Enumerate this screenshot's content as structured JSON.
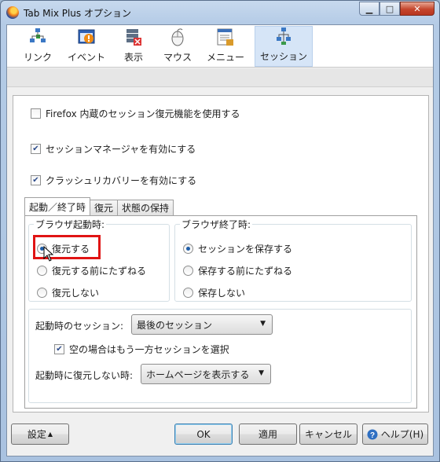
{
  "window": {
    "title": "Tab Mix Plus オプション"
  },
  "toolbar": {
    "items": [
      {
        "label": "リンク"
      },
      {
        "label": "イベント"
      },
      {
        "label": "表示"
      },
      {
        "label": "マウス"
      },
      {
        "label": "メニュー"
      },
      {
        "label": "セッション"
      }
    ]
  },
  "options": {
    "firefox_session": "Firefox 内蔵のセッション復元機能を使用する",
    "session_manager": "セッションマネージャを有効にする",
    "crash_recovery": "クラッシュリカバリーを有効にする"
  },
  "tabs": [
    "起動／終了時",
    "復元",
    "状態の保持"
  ],
  "startup_group": {
    "label": "ブラウザ起動時:",
    "options": [
      "復元する",
      "復元する前にたずねる",
      "復元しない"
    ]
  },
  "exit_group": {
    "label": "ブラウザ終了時:",
    "options": [
      "セッションを保存する",
      "保存する前にたずねる",
      "保存しない"
    ]
  },
  "session_settings": {
    "startup_session_label": "起動時のセッション:",
    "startup_session_value": "最後のセッション",
    "empty_choose": "空の場合はもう一方セッションを選択",
    "no_restore_label": "起動時に復元しない時:",
    "no_restore_value": "ホームページを表示する"
  },
  "footer": {
    "settings": "設定",
    "ok": "OK",
    "apply": "適用",
    "cancel": "キャンセル",
    "help": "ヘルプ(H)"
  }
}
